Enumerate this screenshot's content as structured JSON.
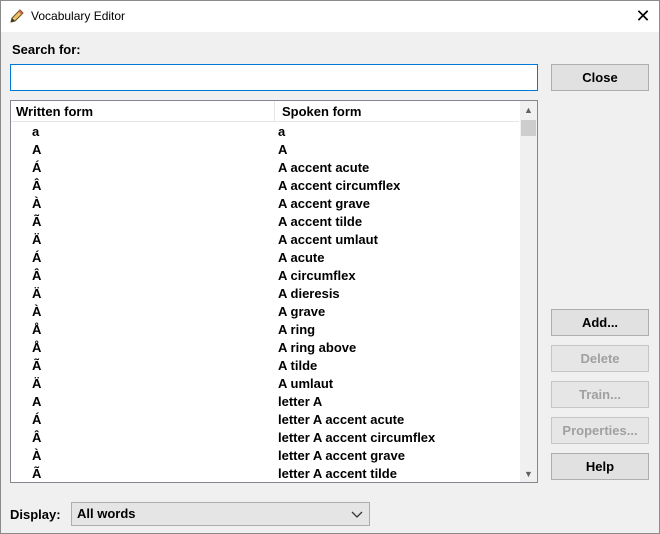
{
  "window": {
    "title": "Vocabulary Editor",
    "close_glyph": "✕",
    "icon": "pencil-icon"
  },
  "search": {
    "label": "Search for:",
    "value": "",
    "placeholder": ""
  },
  "buttons": {
    "close": "Close",
    "add": "Add...",
    "delete": "Delete",
    "train": "Train...",
    "properties": "Properties...",
    "help": "Help"
  },
  "button_states": {
    "delete": "disabled",
    "train": "disabled",
    "properties": "disabled"
  },
  "list": {
    "columns": [
      "Written form",
      "Spoken form"
    ],
    "rows": [
      {
        "written": "a",
        "spoken": "a"
      },
      {
        "written": "A",
        "spoken": "A"
      },
      {
        "written": "Á",
        "spoken": "A accent acute"
      },
      {
        "written": "Â",
        "spoken": "A accent circumflex"
      },
      {
        "written": "À",
        "spoken": "A accent grave"
      },
      {
        "written": "Ã",
        "spoken": "A accent tilde"
      },
      {
        "written": "Ä",
        "spoken": "A accent umlaut"
      },
      {
        "written": "Á",
        "spoken": "A acute"
      },
      {
        "written": "Â",
        "spoken": "A circumflex"
      },
      {
        "written": "Ä",
        "spoken": "A dieresis"
      },
      {
        "written": "À",
        "spoken": "A grave"
      },
      {
        "written": "Å",
        "spoken": "A ring"
      },
      {
        "written": "Å",
        "spoken": "A ring above"
      },
      {
        "written": "Ã",
        "spoken": "A tilde"
      },
      {
        "written": "Ä",
        "spoken": "A umlaut"
      },
      {
        "written": "A",
        "spoken": "letter A"
      },
      {
        "written": "Á",
        "spoken": "letter A accent acute"
      },
      {
        "written": "Â",
        "spoken": "letter A accent circumflex"
      },
      {
        "written": "À",
        "spoken": "letter A accent grave"
      },
      {
        "written": "Ã",
        "spoken": "letter A accent tilde"
      }
    ]
  },
  "display": {
    "label": "Display:",
    "value": "All words"
  }
}
